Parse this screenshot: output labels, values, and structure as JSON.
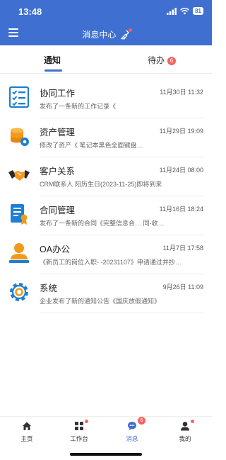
{
  "status_bar": {
    "time": "13:48",
    "battery": "81"
  },
  "header": {
    "title": "消息中心"
  },
  "tabs": [
    {
      "label": "通知",
      "active": true
    },
    {
      "label": "待办",
      "badge": "6"
    }
  ],
  "messages": [
    {
      "icon": "cooperation-icon",
      "name": "协同工作",
      "time": "11月30日 11:32",
      "preview": "发布了一条新的工作记录《"
    },
    {
      "icon": "asset-coins-icon",
      "name": "资产管理",
      "time": "11月29日 19:09",
      "preview": "修改了资产《      笔记本黑色全面键盘…"
    },
    {
      "icon": "handshake-icon",
      "name": "客户关系",
      "time": "11月24日 08:00",
      "preview": "CRM联系人      阳历生日(2023-11-25)即将到来"
    },
    {
      "icon": "contract-icon",
      "name": "合同管理",
      "time": "11月16日 18:24",
      "preview": "发布了一条新的合同《完整信息合…      同-收…"
    },
    {
      "icon": "oa-person-icon",
      "name": "OA办公",
      "time": "11月7日 17:58",
      "preview": "《新员工的岗位入职-      -20231107》申请通过并抄…"
    },
    {
      "icon": "system-gear-icon",
      "name": "系统",
      "time": "9月26日 11:09",
      "preview": "企业发布了新的通知公告《国庆放假通知》"
    }
  ],
  "bottom_nav": [
    {
      "label": "主页",
      "icon": "home-icon"
    },
    {
      "label": "工作台",
      "icon": "workbench-icon",
      "dot": true
    },
    {
      "label": "消息",
      "icon": "message-icon",
      "badge": "6",
      "active": true
    },
    {
      "label": "我的",
      "icon": "profile-icon",
      "dot": true
    }
  ],
  "colors": {
    "primary": "#3f6fd0",
    "badge": "#f4645f",
    "icon_orange": "#f29a1d",
    "icon_blue": "#1f7fd1"
  }
}
